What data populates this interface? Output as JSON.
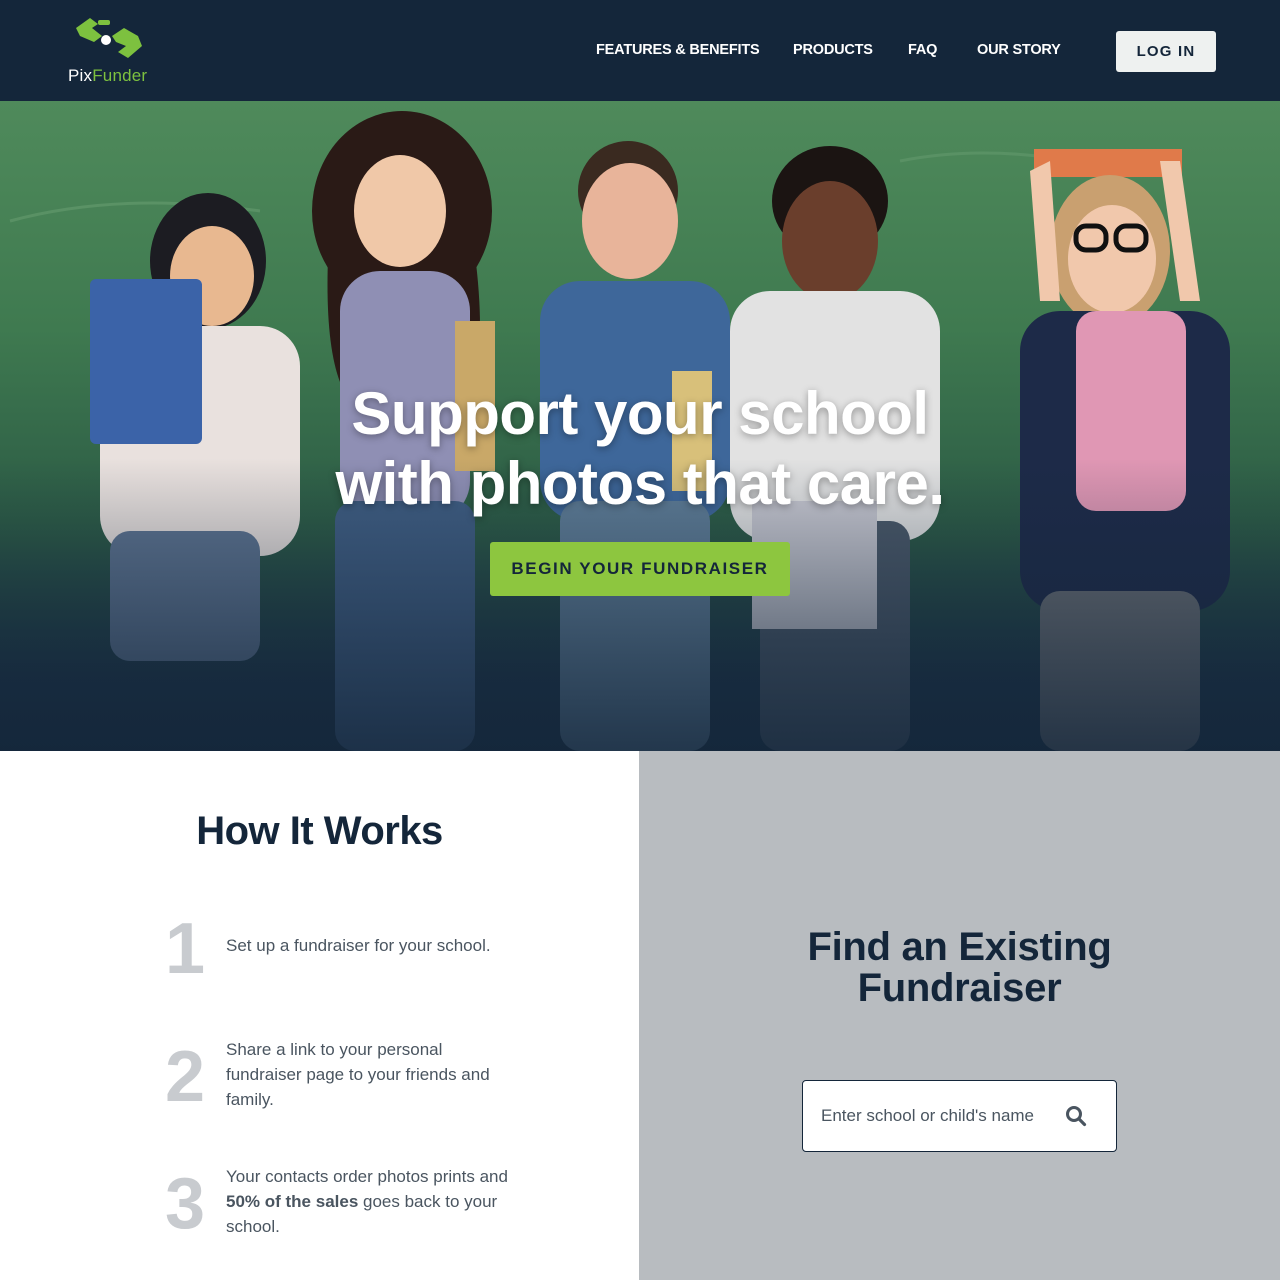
{
  "header": {
    "logo": {
      "pix": "Pix",
      "funder": "Funder"
    },
    "nav": [
      {
        "label": "FEATURES & BENEFITS"
      },
      {
        "label": "PRODUCTS"
      },
      {
        "label": "FAQ"
      },
      {
        "label": "OUR STORY"
      }
    ],
    "login_label": "LOG IN"
  },
  "hero": {
    "title_line1": "Support your school",
    "title_line2": "with photos that care.",
    "cta_label": "BEGIN YOUR FUNDRAISER"
  },
  "how_it_works": {
    "title": "How It Works",
    "steps": [
      {
        "number": "1",
        "text": "Set up a fundraiser for your school."
      },
      {
        "number": "2",
        "text": "Share a link to your personal fundraiser page to your friends and family."
      },
      {
        "number": "3",
        "text_before": "Your contacts order photos prints and ",
        "text_bold": "50% of the sales",
        "text_after": " goes back to your school."
      }
    ]
  },
  "find": {
    "title_line1": "Find an Existing",
    "title_line2": "Fundraiser",
    "search_placeholder": "Enter school or child's name"
  },
  "colors": {
    "navy": "#14263a",
    "accent_green": "#8dc63f",
    "find_panel_bg": "#b8bcc0",
    "step_number_gray": "#c8cbcf"
  },
  "icons": {
    "logo": "pixfunder-logo-icon",
    "search": "search-icon"
  }
}
